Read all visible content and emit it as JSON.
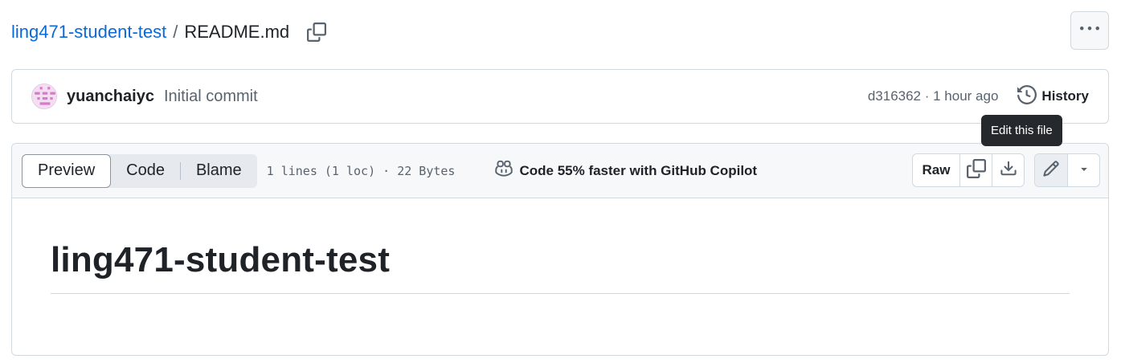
{
  "breadcrumb": {
    "repo": "ling471-student-test",
    "separator": "/",
    "file": "README.md"
  },
  "commit": {
    "author": "yuanchaiyc",
    "message": "Initial commit",
    "meta": "d316362 · 1 hour ago",
    "history_label": "History"
  },
  "tooltip": {
    "text": "Edit this file"
  },
  "file_header": {
    "tabs": [
      {
        "label": "Preview",
        "active": true
      },
      {
        "label": "Code",
        "active": false
      },
      {
        "label": "Blame",
        "active": false
      }
    ],
    "stats": "1 lines (1 loc) · 22 Bytes",
    "copilot": "Code 55% faster with GitHub Copilot",
    "raw_label": "Raw"
  },
  "readme": {
    "heading": "ling471-student-test"
  },
  "icons": [
    "copy-path-icon",
    "kebab-icon",
    "history-icon",
    "copilot-icon",
    "copy-icon",
    "download-icon",
    "pencil-icon",
    "triangle-down-icon"
  ],
  "colors": {
    "link": "#0969da",
    "muted": "#59636e",
    "border": "#d1d9e0",
    "header_bg": "#f6f8fa",
    "tooltip_bg": "#25292e"
  }
}
